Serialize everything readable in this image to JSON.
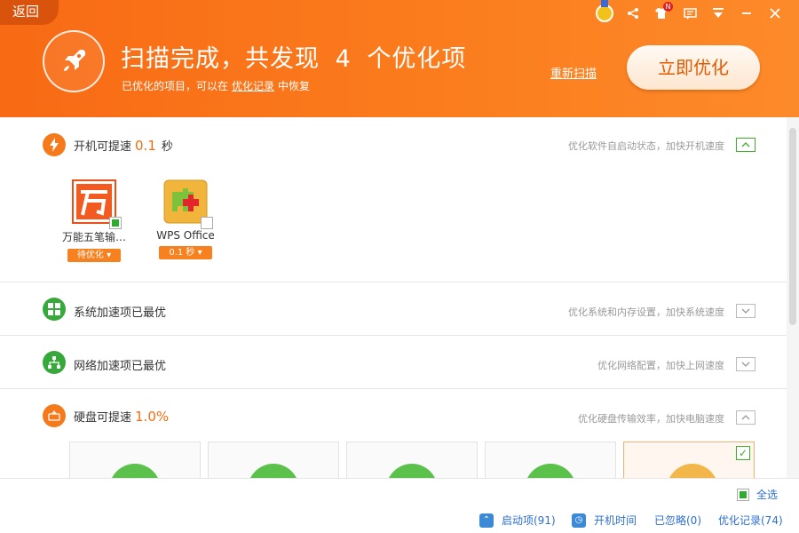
{
  "header": {
    "back_label": "返回",
    "headline_prefix": "扫描完成，共发现",
    "found_count": "4",
    "headline_suffix": "个优化项",
    "sub_prefix": "已优化的项目，可以在",
    "sub_link": "优化记录",
    "sub_suffix": "中恢复",
    "rescan_label": "重新扫描",
    "optimize_label": "立即优化",
    "badge": "N"
  },
  "sections": {
    "startup": {
      "title": "开机可提速",
      "value": "0.1",
      "unit": "秒",
      "desc": "优化软件自启动状态，加快开机速度",
      "apps": [
        {
          "name": "万能五笔输…",
          "tag": "待优化"
        },
        {
          "name": "WPS Office",
          "tag": "0.1 秒"
        }
      ]
    },
    "system": {
      "title": "系统加速项已最优",
      "desc": "优化系统和内存设置，加快系统速度"
    },
    "network": {
      "title": "网络加速项已最优",
      "desc": "优化网络配置，加快上网速度"
    },
    "disk": {
      "title": "硬盘可提速",
      "value": "1.0%",
      "desc": "优化硬盘传输效率，加快电脑速度"
    }
  },
  "footer": {
    "select_all": "全选",
    "links": [
      {
        "label": "启动项(91)",
        "icon": "startup-icon"
      },
      {
        "label": "开机时间",
        "icon": "clock-icon"
      },
      {
        "label": "已忽略(0)",
        "icon": ""
      },
      {
        "label": "优化记录(74)",
        "icon": ""
      }
    ]
  },
  "colors": {
    "accent": "#f86a14",
    "green": "#2eac2d",
    "link": "#2c6fd1"
  }
}
